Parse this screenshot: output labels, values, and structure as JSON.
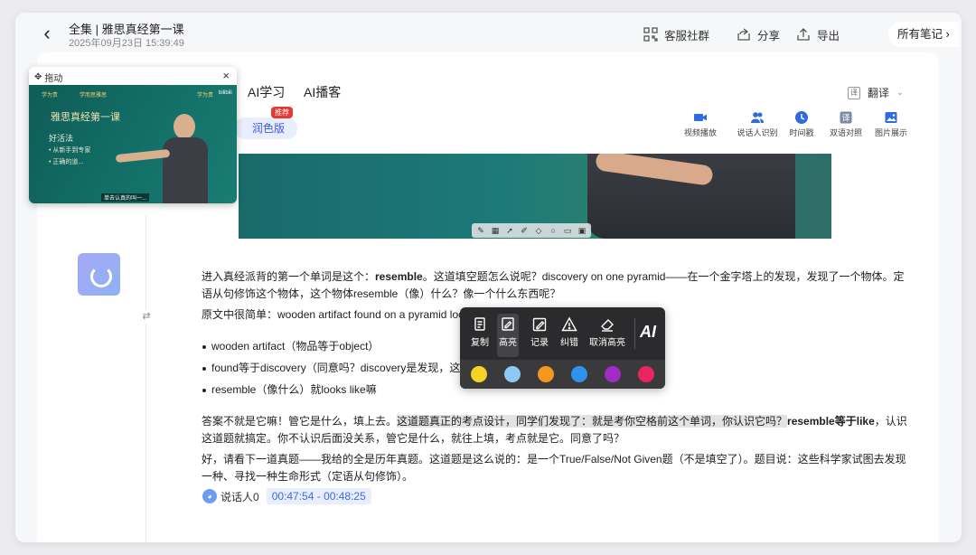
{
  "header": {
    "title": "全集 | 雅思真经第一课",
    "date": "2025年09月23日 15:39:49",
    "actions": [
      {
        "label": "客服社群",
        "icon": "qr-code-icon"
      },
      {
        "label": "分享",
        "icon": "share-icon"
      },
      {
        "label": "导出",
        "icon": "export-icon"
      }
    ],
    "notes_label": "所有笔记",
    "notes_chevron": "›"
  },
  "tabs": [
    {
      "label": "AI学习"
    },
    {
      "label": "AI播客"
    }
  ],
  "translate": {
    "label": "翻译",
    "chevron": "⌄"
  },
  "polish_tab": {
    "label": "润色版",
    "badge": "推荐"
  },
  "tools": [
    {
      "label": "视频播放",
      "icon": "video-camera-icon"
    },
    {
      "label": "说话人识别",
      "icon": "people-icon"
    },
    {
      "label": "时间戳",
      "icon": "clock-icon"
    },
    {
      "label": "双语对照",
      "icon": "bilingual-icon"
    },
    {
      "label": "图片展示",
      "icon": "image-icon"
    }
  ],
  "mini_player": {
    "drag_label": "拖动",
    "close": "×",
    "course_title": "雅思真经第一课",
    "lines": [
      "好活法",
      "• 从新手到专家",
      "• 正确的道..."
    ],
    "logos": [
      "学为贵",
      "学而思雅思",
      "学为贵",
      "bilibili"
    ],
    "caption": "单去认真的叫一..."
  },
  "content": {
    "p1_a": "进入真经派背的第一个单词是这个：",
    "p1_b": "resemble",
    "p1_c": "。这道填空题怎么说呢？discovery on one pyramid——在一个金字塔上的发现，发现了一个物体。定语从句修饰这个物体，这个物体resemble（像）什么？像一个什么东西呢？",
    "p2": "原文中很简单：wooden artifact found on a pyramid looks like。同学们请看好了：",
    "bullets": [
      "wooden artifact（物品等于object）",
      "found等于discovery（同意吗？discovery是发现，这里也是",
      "resemble（像什么）就looks like嘛"
    ],
    "p3_a": "答案不就是它嘛！管它是什么，填上去。",
    "p3_hl": "这道题真正的考点设计，同学们发现了：就是考你空格前这个单词，你认识它吗？",
    "p3_b": "resemble等于like",
    "p3_c": "，认识这道题就搞定。你不认识后面没关系，管它是什么，就往上填，考点就是它。同意了吗？",
    "p4": "好，请看下一道真题——我给的全是历年真题。这道题是这么说的：是一个True/False/Not Given题（不是填空了）。题目说：这些科学家试图去发现一种、寻找一种生命形式（定语从句修饰）。"
  },
  "speaker": {
    "name": "说话人0",
    "timestamp": "00:47:54 - 00:48:25"
  },
  "context_menu": {
    "items": [
      {
        "label": "复制",
        "icon": "copy-icon"
      },
      {
        "label": "高亮",
        "icon": "highlight-icon",
        "active": true
      },
      {
        "label": "记录",
        "icon": "note-icon"
      },
      {
        "label": "纠错",
        "icon": "warning-icon"
      },
      {
        "label": "取消高亮",
        "icon": "eraser-icon"
      }
    ],
    "ai_label": "AI",
    "colors": [
      "#f5d327",
      "#8ec9f3",
      "#f5961e",
      "#2f93ee",
      "#a12bc4",
      "#e9245e"
    ]
  }
}
